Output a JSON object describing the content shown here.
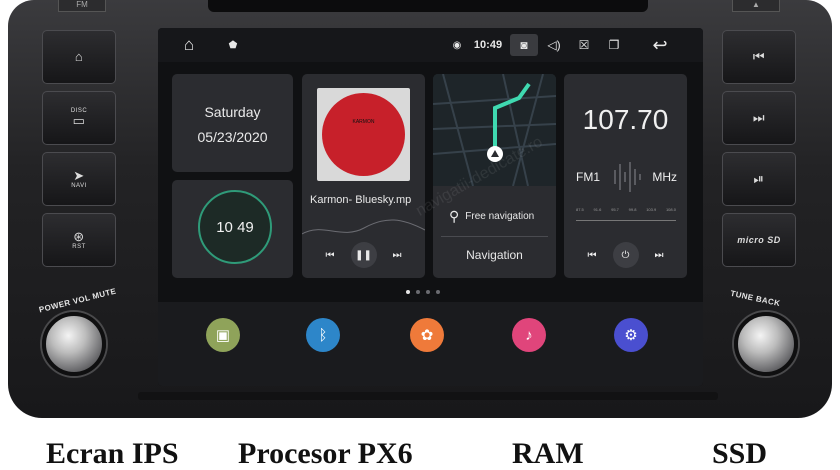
{
  "statusbar": {
    "time": "10:49"
  },
  "hardware": {
    "top_button_label": "FM",
    "left_buttons": [
      {
        "label": ""
      },
      {
        "label": "DISC"
      },
      {
        "label": "NAVI"
      },
      {
        "label": "RST"
      }
    ],
    "right_buttons": [
      {
        "label": ""
      },
      {
        "label": ""
      },
      {
        "label": ""
      },
      {
        "label": "micro SD"
      }
    ],
    "left_knob_label": "POWER VOL MUTE",
    "right_knob_label": "TUNE BACK"
  },
  "date_widget": {
    "day": "Saturday",
    "date": "05/23/2020"
  },
  "clock_widget": {
    "time": "10 49"
  },
  "music_widget": {
    "album_text": "KARMON",
    "song": "Karmon- Bluesky.mp"
  },
  "nav_widget": {
    "free_nav_label": "Free navigation",
    "title": "Navigation"
  },
  "radio_widget": {
    "frequency": "107.70",
    "band": "FM1",
    "unit": "MHz",
    "scale": [
      "87.5",
      "91.6",
      "95.7",
      "99.8",
      "103.9",
      "108.0"
    ]
  },
  "pager": {
    "pages": 4,
    "active": 0
  },
  "dock": [
    {
      "icon": "radio-icon",
      "color": "#8fa35a"
    },
    {
      "icon": "bluetooth-icon",
      "color": "#2d86c9"
    },
    {
      "icon": "film-reel-icon",
      "color": "#ef7a3a"
    },
    {
      "icon": "music-note-icon",
      "color": "#e0457b"
    },
    {
      "icon": "settings-icon",
      "color": "#4a4fd0"
    }
  ],
  "watermark": "navigatii-dedicate.ro",
  "captions": [
    "Ecran IPS",
    "Procesor PX6",
    "RAM",
    "SSD"
  ]
}
